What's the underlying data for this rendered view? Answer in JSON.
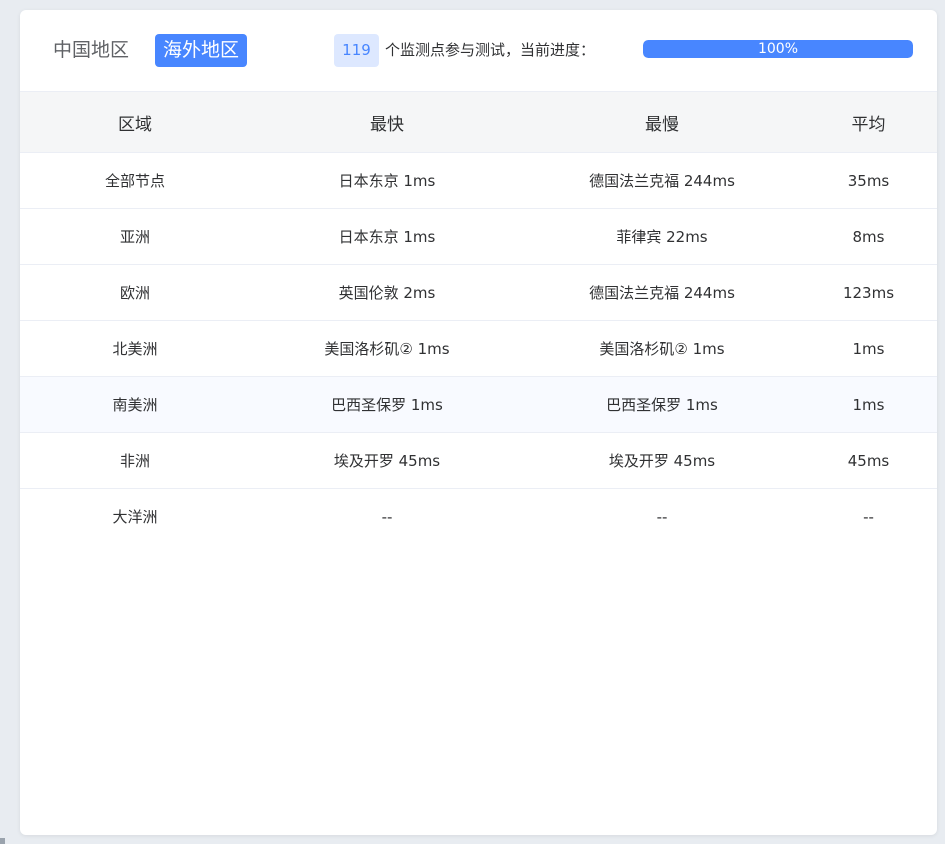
{
  "tabs": {
    "china": "中国地区",
    "overseas": "海外地区"
  },
  "status": {
    "count": "119",
    "text": "个监测点参与测试，当前进度：",
    "progress_label": "100%",
    "progress_value": 100
  },
  "colors": {
    "accent": "#4886ff",
    "badge_bg": "#dde8ff",
    "header_bg": "#f5f6f7"
  },
  "table": {
    "headers": [
      "区域",
      "最快",
      "最慢",
      "平均"
    ],
    "rows": [
      [
        "全部节点",
        "日本东京 1ms",
        "德国法兰克福 244ms",
        "35ms"
      ],
      [
        "亚洲",
        "日本东京 1ms",
        "菲律宾 22ms",
        "8ms"
      ],
      [
        "欧洲",
        "英国伦敦 2ms",
        "德国法兰克福 244ms",
        "123ms"
      ],
      [
        "北美洲",
        "美国洛杉矶② 1ms",
        "美国洛杉矶② 1ms",
        "1ms"
      ],
      [
        "南美洲",
        "巴西圣保罗 1ms",
        "巴西圣保罗 1ms",
        "1ms"
      ],
      [
        "非洲",
        "埃及开罗 45ms",
        "埃及开罗 45ms",
        "45ms"
      ],
      [
        "大洋洲",
        "--",
        "--",
        "--"
      ]
    ]
  }
}
